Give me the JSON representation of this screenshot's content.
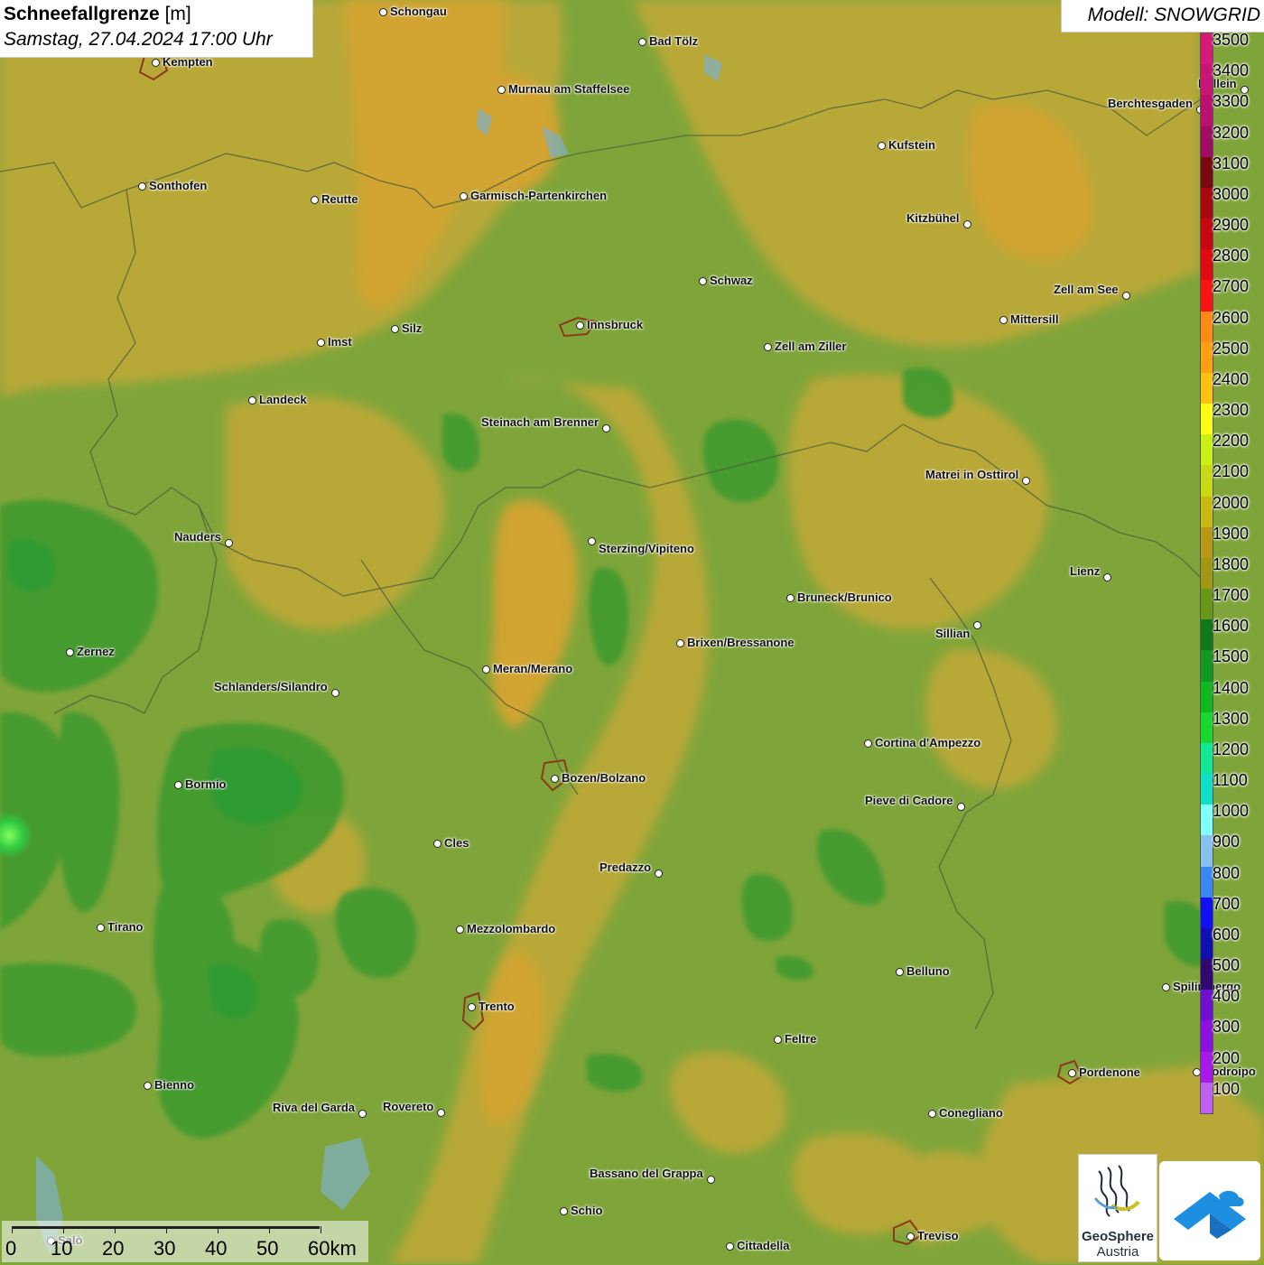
{
  "title": {
    "main": "Schneefallgrenze",
    "unit": " [m]",
    "date": "Samstag, 27.04.2024 17:00 Uhr"
  },
  "model": "Modell: SNOWGRID",
  "legend": {
    "labels": [
      "3500",
      "3400",
      "3300",
      "3200",
      "3100",
      "3000",
      "2900",
      "2800",
      "2700",
      "2600",
      "2500",
      "2400",
      "2300",
      "2200",
      "2100",
      "2000",
      "1900",
      "1800",
      "1700",
      "1600",
      "1500",
      "1400",
      "1300",
      "1200",
      "1100",
      "1000",
      "900",
      "800",
      "700",
      "600",
      "500",
      "400",
      "300",
      "200",
      "100"
    ],
    "colors": [
      "#d61a7a",
      "#c81577",
      "#b81170",
      "#a00d62",
      "#7a0810",
      "#a80810",
      "#c80810",
      "#e00a12",
      "#f81414",
      "#ff8a14",
      "#ffa014",
      "#ffc014",
      "#ffff14",
      "#c8f014",
      "#c8d814",
      "#c8b814",
      "#b89814",
      "#a09814",
      "#689818",
      "#107818",
      "#109820",
      "#10b820",
      "#18d830",
      "#10e898",
      "#10e0c8",
      "#80ffff",
      "#88c0f0",
      "#3888f0",
      "#1010f0",
      "#1010b0",
      "#300870",
      "#7010d0",
      "#8c10e0",
      "#a818e8",
      "#c060f0"
    ]
  },
  "cities": [
    {
      "name": "Schongau"
    },
    {
      "name": "Bad Tölz"
    },
    {
      "name": "Kempten"
    },
    {
      "name": "Murnau am Staffelsee"
    },
    {
      "name": "Berchtesgaden"
    },
    {
      "name": "Kufstein"
    },
    {
      "name": "Sonthofen"
    },
    {
      "name": "Reutte"
    },
    {
      "name": "Garmisch-Partenkirchen"
    },
    {
      "name": "Kitzbühel"
    },
    {
      "name": "Schwaz"
    },
    {
      "name": "Zell am See"
    },
    {
      "name": "Imst"
    },
    {
      "name": "Silz"
    },
    {
      "name": "Innsbruck"
    },
    {
      "name": "Mittersill"
    },
    {
      "name": "Zell am Ziller"
    },
    {
      "name": "Landeck"
    },
    {
      "name": "Steinach am Brenner"
    },
    {
      "name": "Matrei in Osttirol"
    },
    {
      "name": "Nauders"
    },
    {
      "name": "Sterzing/Vipiteno"
    },
    {
      "name": "Lienz"
    },
    {
      "name": "Bruneck/Brunico"
    },
    {
      "name": "Sillian"
    },
    {
      "name": "Brixen/Bressanone"
    },
    {
      "name": "Zernez"
    },
    {
      "name": "Meran/Merano"
    },
    {
      "name": "Schlanders/Silandro"
    },
    {
      "name": "Cortina d'Ampezzo"
    },
    {
      "name": "Bozen/Bolzano"
    },
    {
      "name": "Bormio"
    },
    {
      "name": "Pieve di Cadore"
    },
    {
      "name": "Cles"
    },
    {
      "name": "Predazzo"
    },
    {
      "name": "Tirano"
    },
    {
      "name": "Mezzolombardo"
    },
    {
      "name": "Belluno"
    },
    {
      "name": "Spilimbergo"
    },
    {
      "name": "Trento"
    },
    {
      "name": "Feltre"
    },
    {
      "name": "Pordenone"
    },
    {
      "name": "Bienno"
    },
    {
      "name": "Riva del Garda"
    },
    {
      "name": "Rovereto"
    },
    {
      "name": "Conegliano"
    },
    {
      "name": "Bassano del Grappa"
    },
    {
      "name": "Schio"
    },
    {
      "name": "Treviso"
    },
    {
      "name": "Cittadella"
    },
    {
      "name": "Hallein"
    },
    {
      "name": "Codroipo"
    },
    {
      "name": "Salò"
    }
  ],
  "scale": {
    "labels": [
      "0",
      "10",
      "20",
      "30",
      "40",
      "50",
      "60km"
    ]
  },
  "logos": {
    "geosphere_line1": "GeoSphere",
    "geosphere_line2": "Austria"
  }
}
